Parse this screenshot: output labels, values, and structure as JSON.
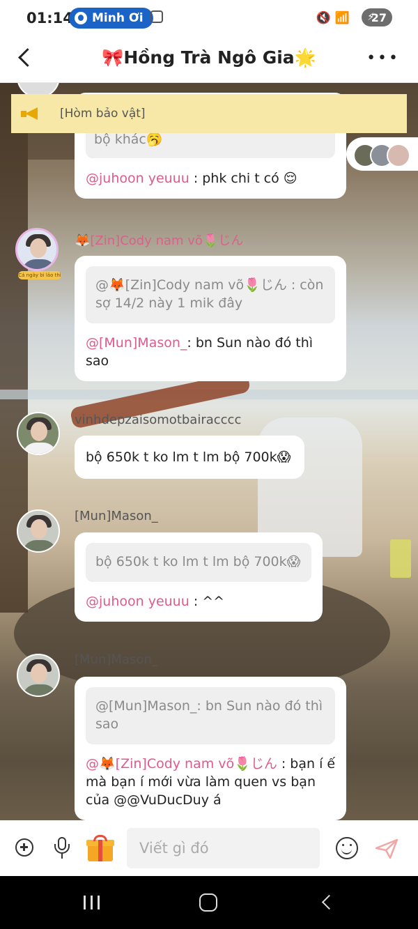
{
  "status_bar": {
    "time": "01:14",
    "profile_chip": "Minh Ơi",
    "battery": "27"
  },
  "header": {
    "title": "🎀Hồng Trà Ngô Gia🌟"
  },
  "pinned": {
    "text": "[Hòm bảo vật]"
  },
  "messages": [
    {
      "reply_tail": "bộ khác🥱",
      "mention": "@juhoon yeuuu",
      "text": " : phk chi t có 😌"
    },
    {
      "sender": "🦊[Zin]Cody nam võ🌷じん",
      "avatar_caption": "Cá ngày bi lảo thì",
      "quote": "@🦊[Zin]Cody nam võ🌷じん : còn sợ 14/2 này 1 mik đây",
      "mention": "@[Mun]Mason_",
      "text": ": bn Sun nào đó thì sao"
    },
    {
      "sender": "vinhdepzaisomotbairacccc",
      "text": "bộ 650k t ko lm t lm bộ 700k😱"
    },
    {
      "sender": "[Mun]Mason_",
      "quote": "bộ 650k t ko lm t lm bộ 700k😱",
      "mention": "@juhoon yeuuu",
      "text": " : ^^"
    },
    {
      "sender": "[Mun]Mason_",
      "quote": "@[Mun]Mason_: bn Sun nào đó thì sao",
      "mention": "@🦊[Zin]Cody nam võ🌷じん",
      "text": " : bạn í ế mà bạn í mới vừa làm quen vs bạn của @@VuDucDuy  á"
    }
  ],
  "composer": {
    "placeholder": "Viết gì đó"
  },
  "colors": {
    "mention": "#e05a8a",
    "pinned_bg": "#f7e8a8",
    "chip": "#1b63c6"
  }
}
